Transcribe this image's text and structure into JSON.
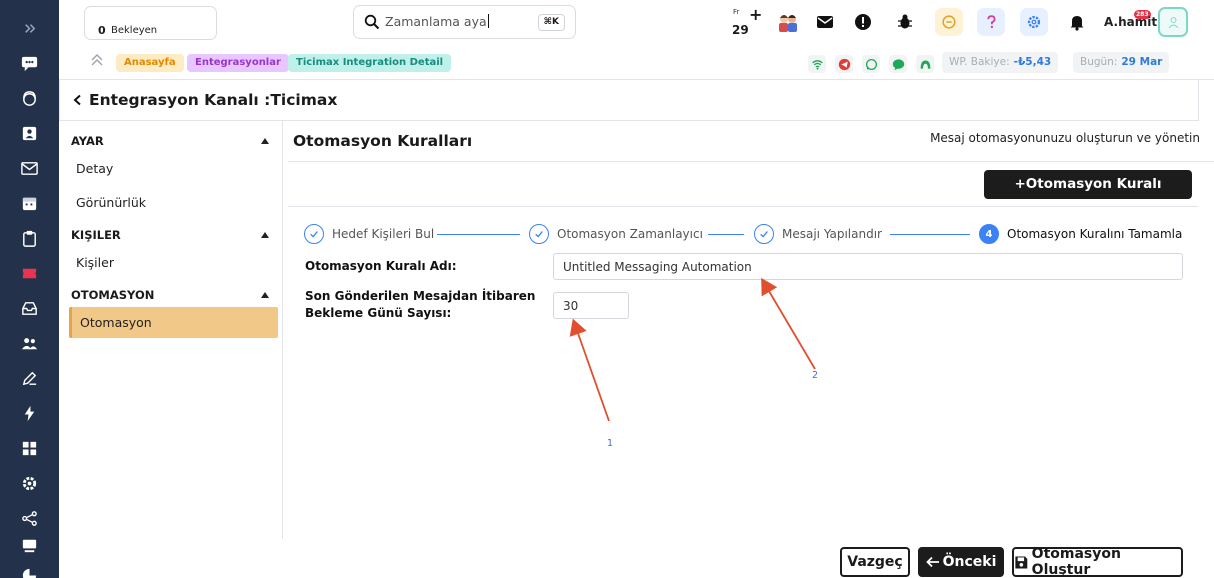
{
  "topbar": {
    "pending_count": "0",
    "pending_label": "Bekleyen",
    "search_value": "Zamanlama aya",
    "search_shortcut": "⌘K",
    "calendar_day_abbr": "Fr",
    "calendar_day": "29",
    "calendar_add": "+",
    "notification_count": "283",
    "username": "A.hamit"
  },
  "breadcrumb": {
    "items": [
      "Anasayfa",
      "Entegrasyonlar",
      "Ticimax Integration Detail"
    ],
    "balance_label": "WP. Bakiye:",
    "balance_value": "-₺5,43",
    "today_label": "Bugün:",
    "today_value": "29 Mar"
  },
  "page": {
    "title": "Entegrasyon Kanalı :Ticimax"
  },
  "menu": {
    "sections": [
      {
        "title": "AYAR",
        "items": [
          "Detay",
          "Görünürlük"
        ]
      },
      {
        "title": "KIŞILER",
        "items": [
          "Kişiler"
        ]
      },
      {
        "title": "OTOMASYON",
        "items": [
          "Otomasyon"
        ]
      }
    ]
  },
  "main": {
    "heading": "Otomasyon Kuralları",
    "subheading": "Mesaj otomasyonunuzu oluşturun ve yönetin",
    "create_button": "+Otomasyon Kuralı Oluştur",
    "steps": [
      {
        "label": "Hedef Kişileri Bul",
        "state": "done"
      },
      {
        "label": "Otomasyon Zamanlayıcı",
        "state": "done"
      },
      {
        "label": "Mesajı Yapılandır",
        "state": "done"
      },
      {
        "label": "Otomasyon Kuralını Tamamla",
        "state": "active",
        "number": "4"
      }
    ],
    "form": {
      "name_label": "Otomasyon Kuralı Adı:",
      "name_value": "Untitled Messaging Automation",
      "wait_label_line1": "Son Gönderilen Mesajdan İtibaren",
      "wait_label_line2": "Bekleme Günü Sayısı:",
      "wait_value": "30"
    },
    "annotations": [
      "1",
      "2"
    ]
  },
  "footer": {
    "cancel": "Vazgeç",
    "previous": "Önceki",
    "submit": "Otomasyon Oluştur"
  },
  "colors": {
    "rail": "#23314a",
    "accent": "#3b82f6",
    "active_menu": "#f1c887",
    "arrow": "#e0502f"
  }
}
